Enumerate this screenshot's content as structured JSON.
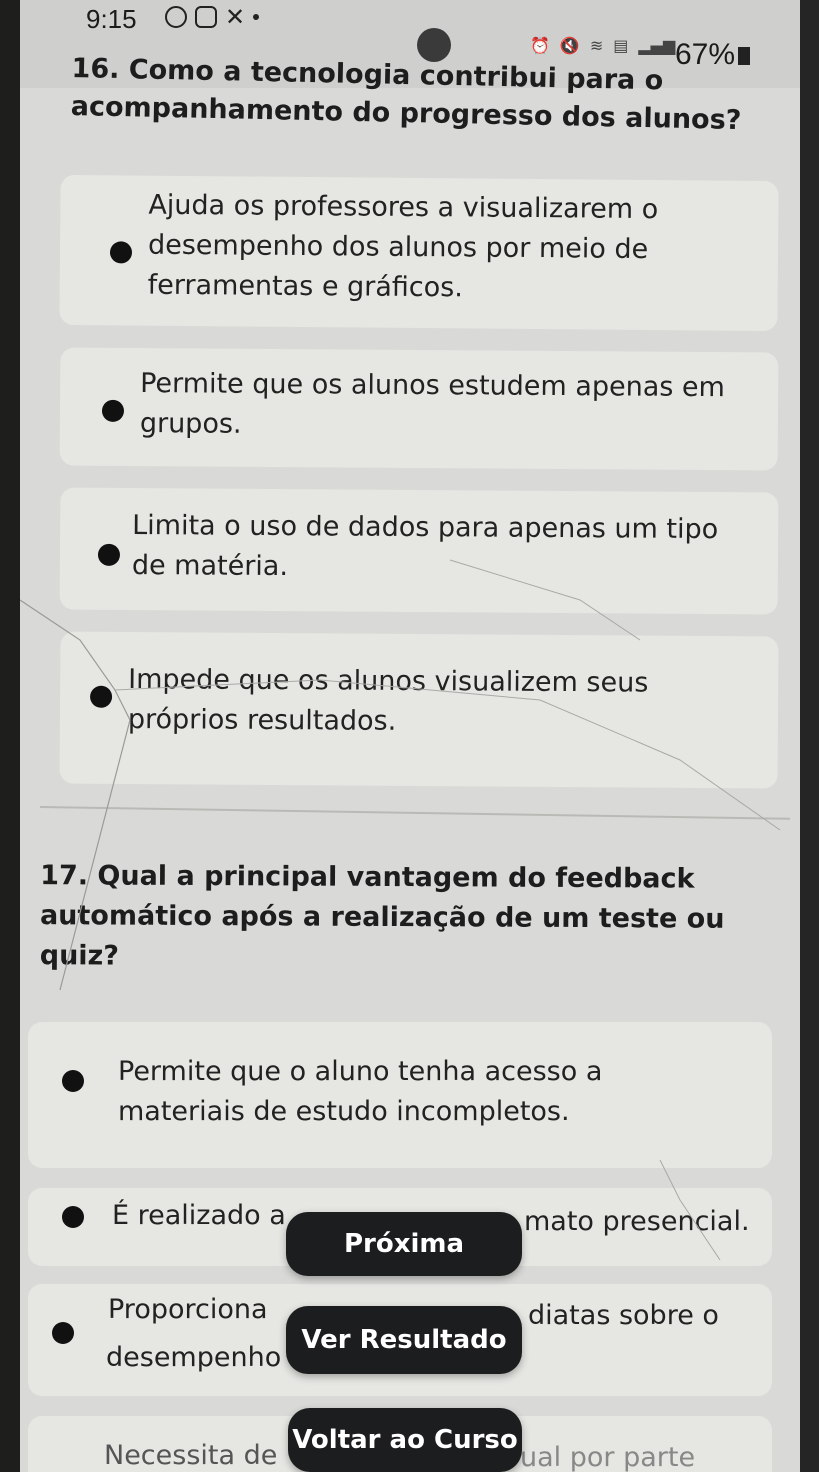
{
  "status_bar": {
    "time": "9:15",
    "battery": "67%"
  },
  "questions": [
    {
      "title": "16. Como a tecnologia contribui para o acompanhamento do progresso dos alunos?",
      "options": [
        "Ajuda os professores a visualizarem o desempenho dos alunos por meio de ferramentas e gráficos.",
        "Permite que os alunos estudem apenas em grupos.",
        "Limita o uso de dados para apenas um tipo de matéria.",
        "Impede que os alunos visualizem seus próprios resultados."
      ]
    },
    {
      "title": "17. Qual a principal vantagem do feedback automático após a realização de um teste ou quiz?",
      "options": [
        "Permite que o aluno tenha acesso a materiais de estudo incompletos.",
        "É realizado a",
        "mato presencial.",
        "Proporciona",
        "diatas sobre o",
        "desempenho",
        "Necessita de",
        "ual por parte"
      ]
    }
  ],
  "buttons": {
    "next": "Próxima",
    "result": "Ver Resultado",
    "back": "Voltar ao Curso"
  }
}
